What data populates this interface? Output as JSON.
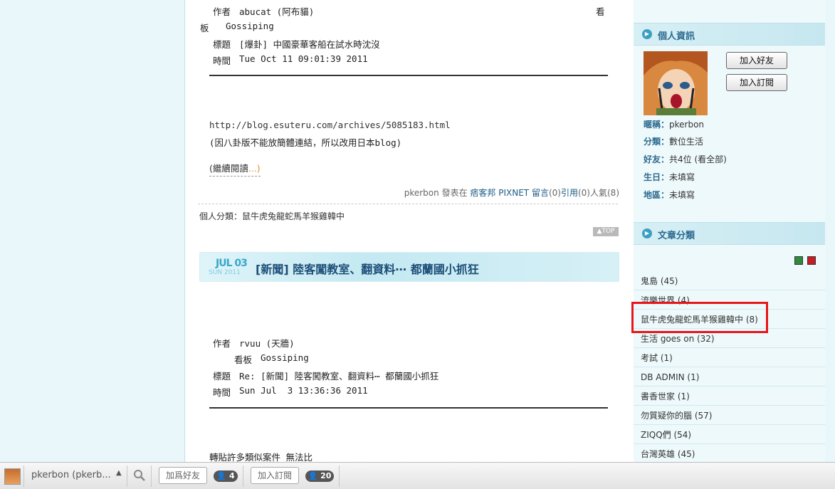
{
  "post1": {
    "author_label": "作者",
    "author": "abucat (阿布貓)",
    "board_label_a": "看",
    "board_label_b": "板",
    "board": "Gossiping",
    "title_label": "標題",
    "title": "[爆卦] 中國豪華客船在試水時沈沒",
    "time_label": "時間",
    "time": "Tue Oct 11 09:01:39 2011",
    "url": "http://blog.esuteru.com/archives/5085183.html",
    "note": "(因八卦版不能放簡體連結，所以改用日本blog)",
    "read_more_prefix": "(繼續閱讀",
    "read_more_suffix": "...)",
    "footer_author": "pkerbon",
    "footer_posted_in": "發表在",
    "footer_site": "痞客邦 PIXNET",
    "footer_comment": "留言",
    "footer_comment_count": "(0)",
    "footer_cite": "引用",
    "footer_cite_count": "(0)",
    "footer_pop": "人氣",
    "footer_pop_count": "(8)",
    "category_line": "個人分類：鼠牛虎兔龍蛇馬羊猴雞韓中",
    "top": "▲TOP"
  },
  "post2": {
    "month_day": "JUL 03",
    "weekday_year": "SUN 2011",
    "title": "[新聞] 陸客闖教室、翻資料⋯ 都蘭國小抓狂",
    "author_label": "作者",
    "author": "rvuu (天牆)",
    "board_label": "看板",
    "board": "Gossiping",
    "title_label": "標題",
    "title_line": "Re: [新聞] 陸客闖教室、翻資料⋯ 都蘭國小抓狂",
    "time_label": "時間",
    "time": "Sun Jul  3 13:36:36 2011",
    "body": "轉貼許多類似案件 無法比"
  },
  "sidebar": {
    "profile_title": "個人資訊",
    "add_friend": "加入好友",
    "subscribe": "加入訂閱",
    "nickname_label": "暱稱：",
    "nickname": "pkerbon",
    "category_label": "分類：",
    "category": "數位生活",
    "friends_label": "好友：",
    "friends": "共4位 (看全部)",
    "birthday_label": "生日：",
    "birthday": "未填寫",
    "region_label": "地區：",
    "region": "未填寫",
    "categories_title": "文章分類",
    "categories": [
      "鬼島 (45)",
      "流樂世界 (4)",
      "鼠牛虎兔龍蛇馬羊猴雞韓中 (8)",
      "生活 goes on (32)",
      "考試 (1)",
      "DB ADMIN (1)",
      "書香世家 (1)",
      "勿質疑你的腦 (57)",
      "ZIQQ們 (54)",
      "台灣英雄 (45)"
    ]
  },
  "bottombar": {
    "username": "pkerbon (pkerb...",
    "add_friend": "加爲好友",
    "friends_count": "4",
    "subscribe": "加入訂閱",
    "subscribers_count": "20"
  },
  "colors": {
    "highlight": "#e8161a",
    "link": "#1d5c86",
    "accent": "#3c9fc2"
  }
}
